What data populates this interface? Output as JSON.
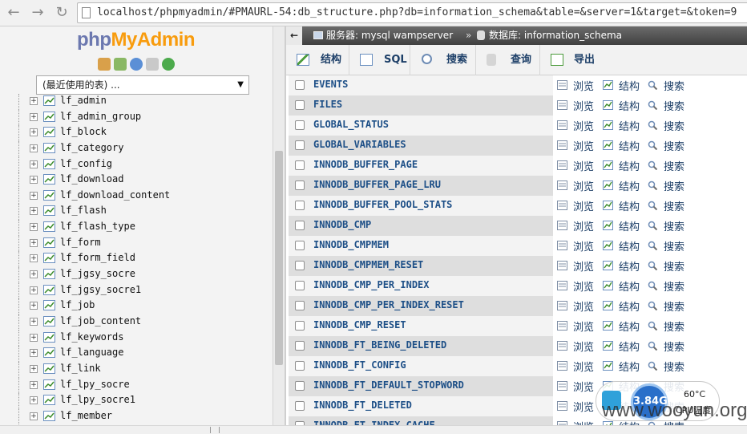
{
  "browser": {
    "back_icon": "back-arrow-icon",
    "forward_icon": "forward-arrow-icon",
    "reload_icon": "reload-icon",
    "url": "localhost/phpmyadmin/#PMAURL-54:db_structure.php?db=information_schema&table=&server=1&target=&token=9"
  },
  "nav": {
    "logo_php": "php",
    "logo_myadmin": "MyAdmin",
    "quick_icons": [
      "home-icon",
      "exit-icon",
      "help-icon",
      "docs-icon",
      "reload-icon"
    ],
    "recent_tables": "(最近使用的表) ...",
    "tables": [
      "lf_admin",
      "lf_admin_group",
      "lf_block",
      "lf_category",
      "lf_config",
      "lf_download",
      "lf_download_content",
      "lf_flash",
      "lf_flash_type",
      "lf_form",
      "lf_form_field",
      "lf_jgsy_socre",
      "lf_jgsy_socre1",
      "lf_job",
      "lf_job_content",
      "lf_keywords",
      "lf_language",
      "lf_link",
      "lf_lpy_socre",
      "lf_lpy_socre1",
      "lf_member"
    ]
  },
  "breadcrumb": {
    "server": "服务器: mysql wampserver",
    "separator": "»",
    "database": "数据库: information_schema"
  },
  "tabs": {
    "structure": "结构",
    "sql": "SQL",
    "search": "搜索",
    "query": "查询",
    "export": "导出"
  },
  "actions": {
    "browse": "浏览",
    "structure": "结构",
    "search": "搜索"
  },
  "schema_tables": [
    "EVENTS",
    "FILES",
    "GLOBAL_STATUS",
    "GLOBAL_VARIABLES",
    "INNODB_BUFFER_PAGE",
    "INNODB_BUFFER_PAGE_LRU",
    "INNODB_BUFFER_POOL_STATS",
    "INNODB_CMP",
    "INNODB_CMPMEM",
    "INNODB_CMPMEM_RESET",
    "INNODB_CMP_PER_INDEX",
    "INNODB_CMP_PER_INDEX_RESET",
    "INNODB_CMP_RESET",
    "INNODB_FT_BEING_DELETED",
    "INNODB_FT_CONFIG",
    "INNODB_FT_DEFAULT_STOPWORD",
    "INNODB_FT_DELETED",
    "INNODB_FT_INDEX_CACHE"
  ],
  "status_widget": {
    "memory": "3.84G",
    "temperature": "60°C",
    "temperature_label": "CPU温度"
  },
  "watermark": "www.wooyun.org",
  "colors": {
    "link_blue": "#1d4f87",
    "tab_text": "#1d3f68",
    "logo_php": "#6c78af",
    "logo_myadmin": "#f89c0e",
    "row_odd": "#f3f3f3",
    "row_even": "#dedede"
  }
}
